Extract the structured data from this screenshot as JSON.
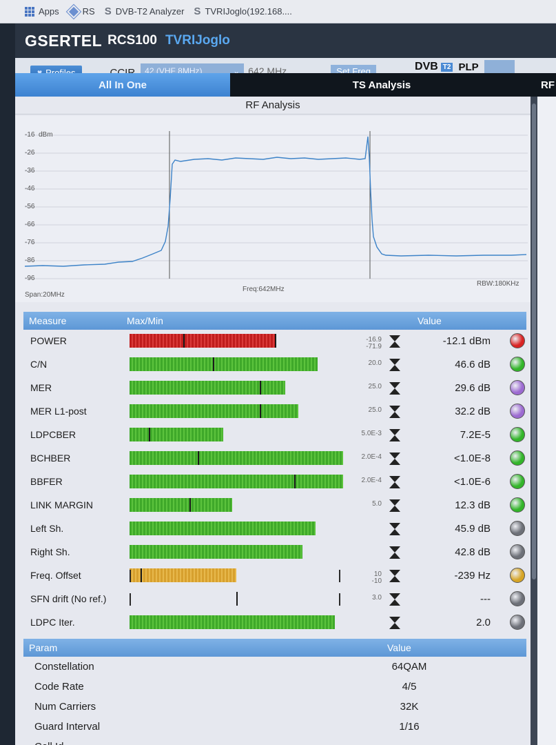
{
  "bookmarks": {
    "apps": "Apps",
    "rs": "RS",
    "dvbt2": "DVB-T2 Analyzer",
    "tvri": "TVRIJoglo(192.168...."
  },
  "app": {
    "brand": "GSERTEL",
    "model": "RCS100",
    "device_name": "TVRIJoglo"
  },
  "toolbar": {
    "profiles_label": "Profiles",
    "standard": "CCIR",
    "channel_selected": "42 (VHF 8MHz)",
    "frequency": "642 MHz",
    "set_freq_label": "Set Freq",
    "dvb_label": "DVB",
    "dvb_suffix": "T2",
    "plp_label": "PLP"
  },
  "tabs": {
    "all_in_one": "All In One",
    "ts_analysis": "TS Analysis",
    "rf": "RF"
  },
  "rf_analysis": {
    "title": "RF Analysis",
    "unit": "dBm",
    "y_ticks": [
      "-16",
      "-26",
      "-36",
      "-46",
      "-56",
      "-66",
      "-76",
      "-86",
      "-96"
    ],
    "span": "Span:20MHz",
    "freq": "Freq:642MHz",
    "rbw": "RBW:180KHz"
  },
  "measure_table": {
    "col_measure": "Measure",
    "col_maxmin": "Max/Min",
    "col_value": "Value",
    "rows": [
      {
        "name": "POWER",
        "fill": 0.68,
        "color": "red",
        "marker": 0.25,
        "thresh_top": "-16.9",
        "thresh_bottom": "-71.9",
        "value": "-12.1 dBm",
        "led": "#d92424"
      },
      {
        "name": "C/N",
        "fill": 0.88,
        "color": "green",
        "marker": 0.39,
        "thresh_top": "20.0",
        "thresh_bottom": "",
        "value": "46.6 dB",
        "led": "#33b52a"
      },
      {
        "name": "MER",
        "fill": 0.73,
        "color": "green",
        "marker": 0.61,
        "thresh_top": "25.0",
        "thresh_bottom": "",
        "value": "29.6 dB",
        "led": "#9c6ad1"
      },
      {
        "name": "MER L1-post",
        "fill": 0.79,
        "color": "green",
        "marker": 0.61,
        "thresh_top": "25.0",
        "thresh_bottom": "",
        "value": "32.2 dB",
        "led": "#9c6ad1"
      },
      {
        "name": "LDPCBER",
        "fill": 0.44,
        "color": "green",
        "marker": 0.09,
        "thresh_top": "5.0E-3",
        "thresh_bottom": "",
        "value": "7.2E-5",
        "led": "#33b52a"
      },
      {
        "name": "BCHBER",
        "fill": 1.0,
        "color": "green",
        "marker": 0.32,
        "thresh_top": "2.0E-4",
        "thresh_bottom": "",
        "value": "<1.0E-8",
        "led": "#33b52a"
      },
      {
        "name": "BBFER",
        "fill": 1.0,
        "color": "green",
        "marker": 0.77,
        "thresh_top": "2.0E-4",
        "thresh_bottom": "",
        "value": "<1.0E-6",
        "led": "#33b52a"
      },
      {
        "name": "LINK MARGIN",
        "fill": 0.48,
        "color": "green",
        "marker": 0.28,
        "thresh_top": "5.0",
        "thresh_bottom": "",
        "value": "12.3 dB",
        "led": "#33b52a"
      },
      {
        "name": "Left Sh.",
        "fill": 0.87,
        "color": "green",
        "marker": -1,
        "thresh_top": "",
        "thresh_bottom": "",
        "value": "45.9 dB",
        "led": "#6d7078"
      },
      {
        "name": "Right Sh.",
        "fill": 0.81,
        "color": "green",
        "marker": -1,
        "thresh_top": "",
        "thresh_bottom": "",
        "value": "42.8 dB",
        "led": "#6d7078"
      },
      {
        "name": "Freq. Offset",
        "fill": 0.5,
        "color": "amber",
        "marker": 0.05,
        "thresh_top": "10",
        "thresh_bottom": "-10",
        "value": "-239 Hz",
        "led": "#d6a526"
      },
      {
        "name": "SFN drift (No ref.)",
        "fill": 0,
        "color": "green",
        "marker": 0.5,
        "thresh_top": "3.0",
        "thresh_bottom": "",
        "value": "---",
        "led": "#6d7078"
      },
      {
        "name": "LDPC Iter.",
        "fill": 0.96,
        "color": "green",
        "marker": -1,
        "thresh_top": "",
        "thresh_bottom": "",
        "value": "2.0",
        "led": "#6d7078"
      }
    ]
  },
  "param_table": {
    "col_param": "Param",
    "col_value": "Value",
    "rows": [
      {
        "name": "Constellation",
        "value": "64QAM"
      },
      {
        "name": "Code Rate",
        "value": "4/5"
      },
      {
        "name": "Num Carriers",
        "value": "32K"
      },
      {
        "name": "Guard Interval",
        "value": "1/16"
      },
      {
        "name": "Cell Id",
        "value": ""
      }
    ]
  }
}
